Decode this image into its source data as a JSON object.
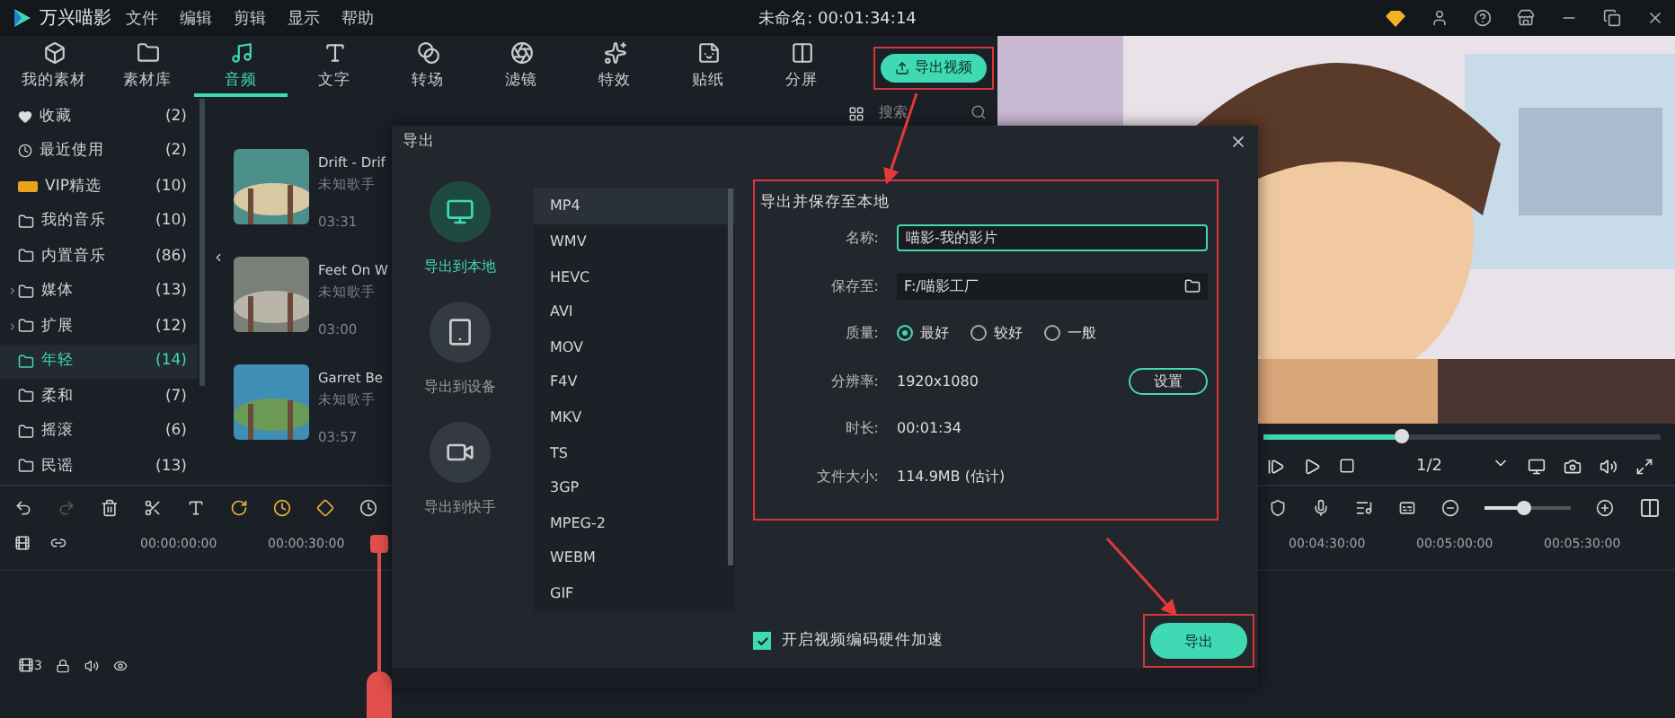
{
  "title_bar": {
    "app_name": "万兴喵影",
    "menus": [
      "文件",
      "编辑",
      "剪辑",
      "显示",
      "帮助"
    ],
    "project_title": "未命名: 00:01:34:14"
  },
  "toolbar": {
    "tabs": [
      {
        "label": "我的素材",
        "selected": false
      },
      {
        "label": "素材库",
        "selected": false
      },
      {
        "label": "音频",
        "selected": true
      },
      {
        "label": "文字",
        "selected": false
      },
      {
        "label": "转场",
        "selected": false
      },
      {
        "label": "滤镜",
        "selected": false
      },
      {
        "label": "特效",
        "selected": false
      },
      {
        "label": "贴纸",
        "selected": false
      },
      {
        "label": "分屏",
        "selected": false
      }
    ],
    "export_button": "导出视频"
  },
  "sidebar": {
    "items": [
      {
        "label": "收藏",
        "count": "(2)",
        "expandable": false,
        "selected": false
      },
      {
        "label": "最近使用",
        "count": "(2)",
        "expandable": false,
        "selected": false
      },
      {
        "label": "VIP精选",
        "count": "(10)",
        "expandable": false,
        "selected": false
      },
      {
        "label": "我的音乐",
        "count": "(10)",
        "expandable": false,
        "selected": false
      },
      {
        "label": "内置音乐",
        "count": "(86)",
        "expandable": false,
        "selected": false
      },
      {
        "label": "媒体",
        "count": "(13)",
        "expandable": true,
        "selected": false
      },
      {
        "label": "扩展",
        "count": "(12)",
        "expandable": true,
        "selected": false
      },
      {
        "label": "年轻",
        "count": "(14)",
        "expandable": false,
        "selected": true
      },
      {
        "label": "柔和",
        "count": "(7)",
        "expandable": false,
        "selected": false
      },
      {
        "label": "摇滚",
        "count": "(6)",
        "expandable": false,
        "selected": false
      },
      {
        "label": "民谣",
        "count": "(13)",
        "expandable": false,
        "selected": false
      }
    ]
  },
  "search": {
    "placeholder": "搜索"
  },
  "music": [
    {
      "title": "Drift - Drif",
      "artist": "未知歌手",
      "duration": "03:31"
    },
    {
      "title": "Feet On W",
      "artist": "未知歌手",
      "duration": "03:00"
    },
    {
      "title": "Garret Be",
      "artist": "未知歌手",
      "duration": "03:57"
    }
  ],
  "preview": {
    "kind": "picture",
    "progress": {
      "level": 0.35
    },
    "page": "1/2"
  },
  "timeline": {
    "zoom": {
      "level": 0.45
    },
    "ruler_left": [
      "00:00:00:00",
      "00:00:30:00"
    ],
    "ruler_right": [
      "00:04:30:00",
      "00:05:00:00",
      "00:05:30:00"
    ],
    "track_number": "3"
  },
  "dialog": {
    "title": "导出",
    "targets": [
      {
        "label": "导出到本地",
        "selected": true
      },
      {
        "label": "导出到设备",
        "selected": false
      },
      {
        "label": "导出到快手",
        "selected": false
      }
    ],
    "formats": [
      {
        "label": "MP4",
        "selected": true
      },
      {
        "label": "WMV",
        "selected": false
      },
      {
        "label": "HEVC",
        "selected": false
      },
      {
        "label": "AVI",
        "selected": false
      },
      {
        "label": "MOV",
        "selected": false
      },
      {
        "label": "F4V",
        "selected": false
      },
      {
        "label": "MKV",
        "selected": false
      },
      {
        "label": "TS",
        "selected": false
      },
      {
        "label": "3GP",
        "selected": false
      },
      {
        "label": "MPEG-2",
        "selected": false
      },
      {
        "label": "WEBM",
        "selected": false
      },
      {
        "label": "GIF",
        "selected": false
      }
    ],
    "settings_title": "导出并保存至本地",
    "name_label": "名称:",
    "name_value": "喵影-我的影片",
    "path_label": "保存至:",
    "path_value": "F:/喵影工厂",
    "quality_label": "质量:",
    "quality_options": [
      {
        "label": "最好",
        "selected": true
      },
      {
        "label": "较好",
        "selected": false
      },
      {
        "label": "一般",
        "selected": false
      }
    ],
    "resolution_label": "分辨率:",
    "resolution_value": "1920x1080",
    "settings_button": "设置",
    "duration_label": "时长:",
    "duration_value": "00:01:34",
    "size_label": "文件大小:",
    "size_value": "114.9MB (估计)",
    "hw_accel": {
      "label": "开启视频编码硬件加速",
      "checked": true
    },
    "export_button": "导出"
  }
}
